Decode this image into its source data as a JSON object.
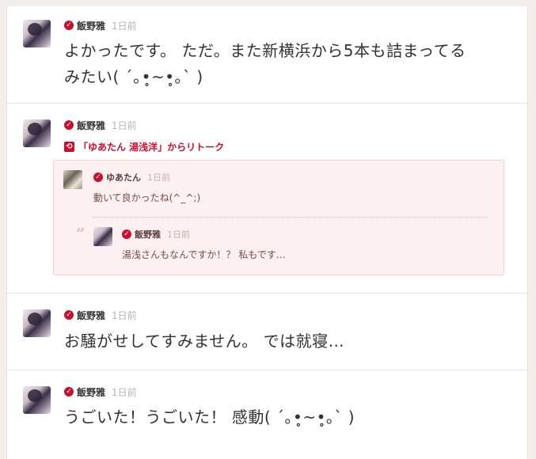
{
  "posts": [
    {
      "author": "飯野雅",
      "time": "1日前",
      "lines": [
        "よかったです。 ただ。また新横浜から5本も詰まってる",
        "みたい( ´｡•̥~•̥｡` )"
      ]
    },
    {
      "author": "飯野雅",
      "time": "1日前",
      "retalk_label": "「ゆあたん 湯浅洋」からリトーク",
      "quoted": {
        "author": "ゆあたん",
        "time": "1日前",
        "text": "動いて良かったね(^_^;)",
        "nested": {
          "author": "飯野雅",
          "time": "1日前",
          "text": "湯浅さんもなんですか！？ 私もです…"
        }
      }
    },
    {
      "author": "飯野雅",
      "time": "1日前",
      "lines": [
        "お騒がせしてすみません。 では就寝…"
      ]
    },
    {
      "author": "飯野雅",
      "time": "1日前",
      "lines": [
        "うごいた！うごいた！ 感動( ´｡•̥~•̥｡` )"
      ]
    }
  ],
  "colors": {
    "accent": "#c8102e",
    "quote_bg": "#fcf0f0",
    "page_bg": "#f3efec"
  },
  "icons": {
    "verified": "check-badge-icon",
    "retalk": "retalk-icon",
    "quote": "quote-mark-icon"
  }
}
